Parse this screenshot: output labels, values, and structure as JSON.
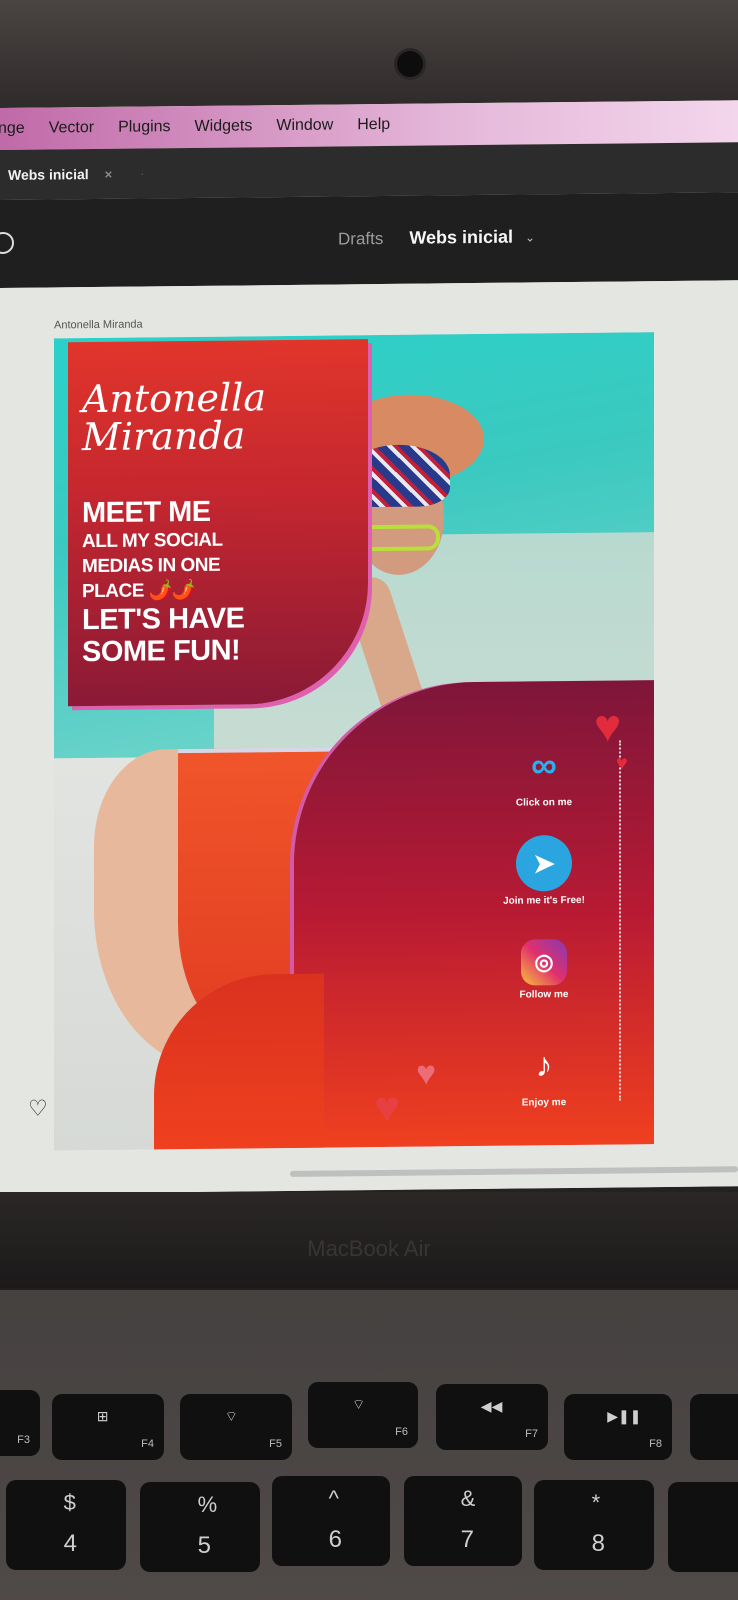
{
  "menubar": {
    "items": [
      "nge",
      "Vector",
      "Plugins",
      "Widgets",
      "Window",
      "Help"
    ]
  },
  "tabbar": {
    "tab_label": "Webs inicial",
    "close_glyph": "×",
    "extra_glyph": "·"
  },
  "toolbar": {
    "drafts": "Drafts",
    "file_name": "Webs inicial",
    "chevron": "⌄"
  },
  "canvas": {
    "frame_label": "Antonella Miranda",
    "artboard": {
      "name_line1": "Antonella",
      "name_line2": "Miranda",
      "tagline": {
        "line1": "MEET ME",
        "line2": "ALL MY SOCIAL",
        "line3": "MEDIAS IN ONE",
        "line4": "PLACE 🌶️🌶️",
        "line5": "LET'S HAVE",
        "line6": "SOME FUN!"
      },
      "socials": [
        {
          "label": "Click on me",
          "icon": "onlyfans-icon",
          "glyph": "∞"
        },
        {
          "label": "Join me it's Free!",
          "icon": "telegram-icon",
          "glyph": "➤"
        },
        {
          "label": "Follow me",
          "icon": "instagram-icon",
          "glyph": "◎"
        },
        {
          "label": "Enjoy me",
          "icon": "tiktok-icon",
          "glyph": "♪"
        }
      ]
    }
  },
  "laptop": {
    "brand": "MacBook Air",
    "fn_keys": [
      {
        "fn": "F3",
        "glyph": "▭"
      },
      {
        "fn": "F4",
        "glyph": "⊞"
      },
      {
        "fn": "F5",
        "glyph": "⌔"
      },
      {
        "fn": "F6",
        "glyph": "⌔"
      },
      {
        "fn": "F7",
        "glyph": "◀◀"
      },
      {
        "fn": "F8",
        "glyph": "▶❚❚"
      }
    ],
    "num_keys": [
      {
        "top": "$",
        "bottom": "4"
      },
      {
        "top": "%",
        "bottom": "5"
      },
      {
        "top": "^",
        "bottom": "6"
      },
      {
        "top": "&",
        "bottom": "7"
      },
      {
        "top": "*",
        "bottom": "8"
      }
    ]
  },
  "colors": {
    "menubar_accent": "#c06aa8",
    "panel_red": "#e1352b",
    "panel_wine": "#7e163a",
    "pool": "#2ad1c8"
  }
}
